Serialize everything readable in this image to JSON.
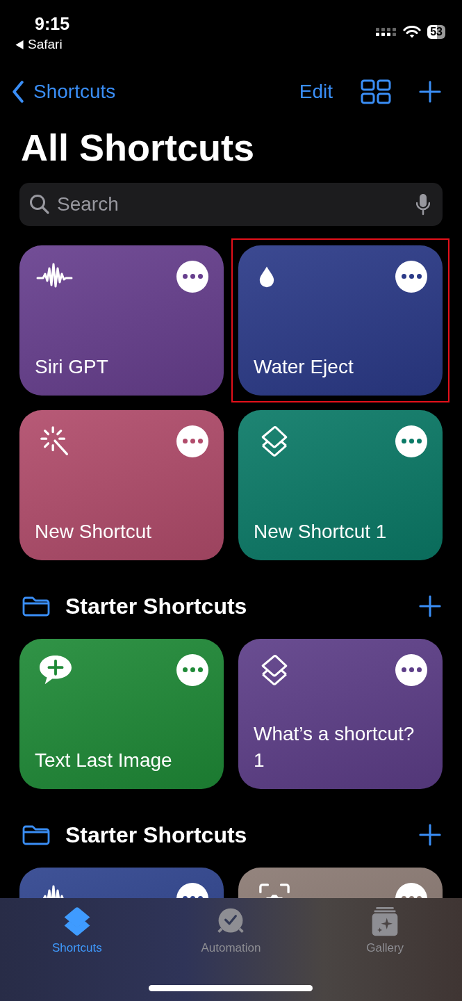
{
  "status_bar": {
    "time": "9:15",
    "back_app": "Safari",
    "battery": "53"
  },
  "nav": {
    "back_label": "Shortcuts",
    "edit": "Edit"
  },
  "title": "All Shortcuts",
  "search": {
    "placeholder": "Search"
  },
  "sections": [
    {
      "tiles": [
        {
          "kind": "waveform",
          "title": "Siri GPT",
          "color": "#673f8e"
        },
        {
          "kind": "drop",
          "title": "Water Eject",
          "color": "#2b3a88",
          "highlighted": true
        },
        {
          "kind": "wand",
          "title": "New Shortcut",
          "color": "#b14c6b"
        },
        {
          "kind": "layers",
          "title": "New Shortcut 1",
          "color": "#0b7a67"
        }
      ]
    },
    {
      "header": "Starter Shortcuts",
      "tiles": [
        {
          "kind": "chat-plus",
          "title": "Text Last Image",
          "color": "#1f8a37"
        },
        {
          "kind": "layers",
          "title": "What’s a shortcut? 1",
          "color": "#5d3e88"
        }
      ]
    },
    {
      "header": "Starter Shortcuts",
      "tiles": [
        {
          "kind": "waveform",
          "color": "#2f448e"
        },
        {
          "kind": "camera",
          "color": "#8b7a73"
        }
      ]
    }
  ],
  "tabs": [
    {
      "kind": "layers",
      "label": "Shortcuts",
      "selected": true
    },
    {
      "kind": "clock",
      "label": "Automation",
      "selected": false
    },
    {
      "kind": "gallery",
      "label": "Gallery",
      "selected": false
    }
  ]
}
